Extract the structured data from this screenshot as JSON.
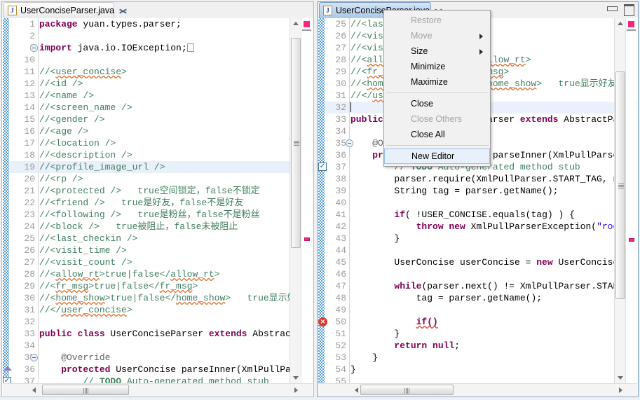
{
  "left_editor": {
    "tab": {
      "label": "UserConciseParser.java",
      "icon": "java-file-icon",
      "close_icon": "close-icon"
    },
    "lines": [
      {
        "n": "1",
        "segs": [
          {
            "t": "package ",
            "c": "kw"
          },
          {
            "t": "yuan.types.parser;",
            "c": "plain"
          }
        ]
      },
      {
        "n": "2",
        "segs": []
      },
      {
        "n": "3",
        "fold": true,
        "segs": [
          {
            "t": "import ",
            "c": "kw"
          },
          {
            "t": "java.io.IOException;",
            "c": "plain"
          },
          {
            "t": "[BOX]",
            "c": "box"
          }
        ]
      },
      {
        "n": "10",
        "segs": []
      },
      {
        "n": "11",
        "segs": [
          {
            "t": "//<",
            "c": "cmt"
          },
          {
            "t": "user_concise",
            "c": "cmt sq"
          },
          {
            "t": ">",
            "c": "cmt"
          }
        ]
      },
      {
        "n": "12",
        "segs": [
          {
            "t": "//<id />",
            "c": "cmt"
          }
        ]
      },
      {
        "n": "13",
        "segs": [
          {
            "t": "//<name />",
            "c": "cmt"
          }
        ]
      },
      {
        "n": "14",
        "segs": [
          {
            "t": "//<screen_name />",
            "c": "cmt"
          }
        ]
      },
      {
        "n": "15",
        "segs": [
          {
            "t": "//<gender />",
            "c": "cmt"
          }
        ]
      },
      {
        "n": "16",
        "segs": [
          {
            "t": "//<age />",
            "c": "cmt"
          }
        ]
      },
      {
        "n": "17",
        "segs": [
          {
            "t": "//<location />",
            "c": "cmt"
          }
        ]
      },
      {
        "n": "18",
        "segs": [
          {
            "t": "//<description />",
            "c": "cmt"
          }
        ]
      },
      {
        "n": "19",
        "hl": true,
        "segs": [
          {
            "t": "//<profile_image_url />",
            "c": "cmt"
          }
        ]
      },
      {
        "n": "20",
        "segs": [
          {
            "t": "//<rp />",
            "c": "cmt"
          }
        ]
      },
      {
        "n": "21",
        "segs": [
          {
            "t": "//<protected />   true空间锁定，false不锁定",
            "c": "cmt"
          }
        ]
      },
      {
        "n": "22",
        "segs": [
          {
            "t": "//<friend />   true是好友，false不是好友",
            "c": "cmt"
          }
        ]
      },
      {
        "n": "23",
        "segs": [
          {
            "t": "//<following />   true是粉丝，false不是粉丝",
            "c": "cmt"
          }
        ]
      },
      {
        "n": "24",
        "segs": [
          {
            "t": "//<block />   true被阻止，false未被阻止",
            "c": "cmt"
          }
        ]
      },
      {
        "n": "25",
        "segs": [
          {
            "t": "//<last_checkin />",
            "c": "cmt"
          }
        ]
      },
      {
        "n": "26",
        "segs": [
          {
            "t": "//<visit_time />",
            "c": "cmt"
          }
        ]
      },
      {
        "n": "27",
        "segs": [
          {
            "t": "//<visit_count />",
            "c": "cmt"
          }
        ]
      },
      {
        "n": "28",
        "segs": [
          {
            "t": "//<",
            "c": "cmt"
          },
          {
            "t": "allow_rt",
            "c": "cmt sq"
          },
          {
            "t": ">true|false</",
            "c": "cmt"
          },
          {
            "t": "allow_rt",
            "c": "cmt sq"
          },
          {
            "t": ">",
            "c": "cmt"
          }
        ]
      },
      {
        "n": "29",
        "segs": [
          {
            "t": "//<",
            "c": "cmt"
          },
          {
            "t": "fr_msg",
            "c": "cmt sq"
          },
          {
            "t": ">true|false</",
            "c": "cmt"
          },
          {
            "t": "fr_msg",
            "c": "cmt sq"
          },
          {
            "t": ">",
            "c": "cmt"
          }
        ]
      },
      {
        "n": "30",
        "segs": [
          {
            "t": "//<",
            "c": "cmt"
          },
          {
            "t": "home_show",
            "c": "cmt sq"
          },
          {
            "t": ">true|false</",
            "c": "cmt"
          },
          {
            "t": "home_show",
            "c": "cmt sq"
          },
          {
            "t": ">   true显示好...",
            "c": "cmt"
          }
        ]
      },
      {
        "n": "31",
        "segs": [
          {
            "t": "//</",
            "c": "cmt"
          },
          {
            "t": "user_concise",
            "c": "cmt sq"
          },
          {
            "t": ">",
            "c": "cmt"
          }
        ]
      },
      {
        "n": "32",
        "segs": []
      },
      {
        "n": "33",
        "segs": [
          {
            "t": "public class ",
            "c": "kw"
          },
          {
            "t": "UserConciseParser ",
            "c": "plain"
          },
          {
            "t": "extends ",
            "c": "kw"
          },
          {
            "t": "Abstract",
            "c": "plain"
          }
        ]
      },
      {
        "n": "34",
        "segs": []
      },
      {
        "n": "35",
        "fold2": true,
        "segs": [
          {
            "t": "    @Override",
            "c": "ann"
          }
        ]
      },
      {
        "n": "36",
        "tri": true,
        "segs": [
          {
            "t": "    protected ",
            "c": "kw"
          },
          {
            "t": "UserConcise parseInner(XmlPullPar",
            "c": "plain"
          }
        ]
      },
      {
        "n": "37",
        "chk": true,
        "segs": [
          {
            "t": "        // ",
            "c": "cmt"
          },
          {
            "t": "TODO",
            "c": "todo"
          },
          {
            "t": " Auto-generated method stub",
            "c": "cmt"
          }
        ]
      }
    ]
  },
  "right_editor": {
    "tab": {
      "label": "UserConciseParser.java",
      "icon": "java-file-icon",
      "close_icon": "close-icon"
    },
    "window_buttons": {
      "minimize": "minimize-icon",
      "maximize": "maximize-icon"
    },
    "lines": [
      {
        "n": "25",
        "segs": [
          {
            "t": "//<last_checkin />",
            "c": "cmt"
          }
        ]
      },
      {
        "n": "26",
        "segs": [
          {
            "t": "//<visit_time />",
            "c": "cmt"
          }
        ]
      },
      {
        "n": "27",
        "segs": [
          {
            "t": "//<visit_count />",
            "c": "cmt"
          }
        ]
      },
      {
        "n": "28",
        "segs": [
          {
            "t": "//<",
            "c": "cmt"
          },
          {
            "t": "allow_rt",
            "c": "cmt sq"
          },
          {
            "t": ">true|false</",
            "c": "cmt"
          },
          {
            "t": "allow_rt",
            "c": "cmt sq"
          },
          {
            "t": ">",
            "c": "cmt"
          }
        ]
      },
      {
        "n": "29",
        "segs": [
          {
            "t": "//<",
            "c": "cmt"
          },
          {
            "t": "fr_msg",
            "c": "cmt sq"
          },
          {
            "t": ">true|false</",
            "c": "cmt"
          },
          {
            "t": "fr_msg",
            "c": "cmt sq"
          },
          {
            "t": ">",
            "c": "cmt"
          }
        ]
      },
      {
        "n": "30",
        "segs": [
          {
            "t": "//<",
            "c": "cmt"
          },
          {
            "t": "home_show",
            "c": "cmt sq"
          },
          {
            "t": ">true|false</",
            "c": "cmt"
          },
          {
            "t": "home_show",
            "c": "cmt sq"
          },
          {
            "t": ">   true显示好友",
            "c": "cmt"
          }
        ]
      },
      {
        "n": "31",
        "segs": [
          {
            "t": "//</",
            "c": "cmt"
          },
          {
            "t": "user_concise",
            "c": "cmt sq"
          },
          {
            "t": ">",
            "c": "cmt"
          }
        ]
      },
      {
        "n": "32",
        "hl": true,
        "caret": true,
        "segs": []
      },
      {
        "n": "33",
        "segs": [
          {
            "t": "public class ",
            "c": "kw"
          },
          {
            "t": "UserConciseParser ",
            "c": "plain"
          },
          {
            "t": "extends ",
            "c": "kw"
          },
          {
            "t": "AbstractPa",
            "c": "plain"
          }
        ]
      },
      {
        "n": "34",
        "segs": []
      },
      {
        "n": "35",
        "fold2": true,
        "segs": [
          {
            "t": "    @Override",
            "c": "ann"
          }
        ]
      },
      {
        "n": "36",
        "segs": [
          {
            "t": "    protected ",
            "c": "kw"
          },
          {
            "t": "UserConcise parseInner(XmlPullParse",
            "c": "plain"
          }
        ]
      },
      {
        "n": "37",
        "chk": true,
        "segs": [
          {
            "t": "        // ",
            "c": "cmt"
          },
          {
            "t": "TODO",
            "c": "todo"
          },
          {
            "t": " Auto-generated method stub",
            "c": "cmt"
          }
        ]
      },
      {
        "n": "38",
        "segs": [
          {
            "t": "        parser.require(XmlPullParser.START_TAG, n",
            "c": "plain"
          }
        ]
      },
      {
        "n": "39",
        "segs": [
          {
            "t": "        String tag = parser.getName();",
            "c": "plain"
          }
        ]
      },
      {
        "n": "40",
        "segs": []
      },
      {
        "n": "41",
        "segs": [
          {
            "t": "        ",
            "c": "plain"
          },
          {
            "t": "if",
            "c": "kw"
          },
          {
            "t": "( !USER_CONCISE.equals(tag) ) {",
            "c": "plain"
          }
        ]
      },
      {
        "n": "42",
        "segs": [
          {
            "t": "            ",
            "c": "plain"
          },
          {
            "t": "throw new ",
            "c": "kw"
          },
          {
            "t": "XmlPullParserException(",
            "c": "plain"
          },
          {
            "t": "\"roo",
            "c": "str"
          }
        ]
      },
      {
        "n": "43",
        "segs": [
          {
            "t": "        }",
            "c": "plain"
          }
        ]
      },
      {
        "n": "44",
        "segs": []
      },
      {
        "n": "45",
        "segs": [
          {
            "t": "        UserConcise userConcise = ",
            "c": "plain"
          },
          {
            "t": "new ",
            "c": "kw"
          },
          {
            "t": "UserConcise",
            "c": "plain"
          }
        ]
      },
      {
        "n": "46",
        "segs": []
      },
      {
        "n": "47",
        "segs": [
          {
            "t": "        ",
            "c": "plain"
          },
          {
            "t": "while",
            "c": "kw"
          },
          {
            "t": "(parser.next() != XmlPullParser.STAR",
            "c": "plain"
          }
        ]
      },
      {
        "n": "48",
        "segs": [
          {
            "t": "            tag = parser.getName();",
            "c": "plain"
          }
        ]
      },
      {
        "n": "49",
        "segs": []
      },
      {
        "n": "50",
        "err": true,
        "segs": [
          {
            "t": "            ",
            "c": "plain"
          },
          {
            "t": "if()",
            "c": "kw sqr"
          }
        ]
      },
      {
        "n": "51",
        "segs": [
          {
            "t": "        }",
            "c": "plain"
          }
        ]
      },
      {
        "n": "52",
        "segs": [
          {
            "t": "        ",
            "c": "plain"
          },
          {
            "t": "return null",
            "c": "kw"
          },
          {
            "t": ";",
            "c": "plain"
          }
        ]
      },
      {
        "n": "53",
        "segs": [
          {
            "t": "    }",
            "c": "plain"
          }
        ]
      },
      {
        "n": "54",
        "segs": [
          {
            "t": "}",
            "c": "plain"
          }
        ]
      },
      {
        "n": "55",
        "segs": []
      }
    ]
  },
  "context_menu": {
    "items": [
      {
        "label": "Restore",
        "disabled": true,
        "submenu": false,
        "selected": false
      },
      {
        "label": "Move",
        "disabled": true,
        "submenu": true,
        "selected": false
      },
      {
        "label": "Size",
        "disabled": false,
        "submenu": true,
        "selected": false
      },
      {
        "label": "Minimize",
        "disabled": false,
        "submenu": false,
        "selected": false
      },
      {
        "label": "Maximize",
        "disabled": false,
        "submenu": false,
        "selected": false
      },
      {
        "separator": true
      },
      {
        "label": "Close",
        "disabled": false,
        "submenu": false,
        "selected": false
      },
      {
        "label": "Close Others",
        "disabled": true,
        "submenu": false,
        "selected": false
      },
      {
        "label": "Close All",
        "disabled": false,
        "submenu": false,
        "selected": false
      },
      {
        "separator": true
      },
      {
        "label": "New Editor",
        "disabled": false,
        "submenu": false,
        "selected": true
      }
    ]
  },
  "colors": {
    "keyword": "#7f0055",
    "comment": "#3f7f5f",
    "string": "#2a00ff",
    "annotation": "#646464",
    "selection": "#e8f0fb",
    "change_bar": "#4e9bd8",
    "error_marker": "#d93b2b",
    "overview_marker": "#f5277f",
    "tab_active": "#bed5ee"
  },
  "scrollbars": {
    "left_vertical_thumb_pct": 58,
    "left_horizontal_thumb_pct": 40,
    "right_vertical_thumb_pct": 74,
    "right_horizontal_thumb_pct": 40
  }
}
